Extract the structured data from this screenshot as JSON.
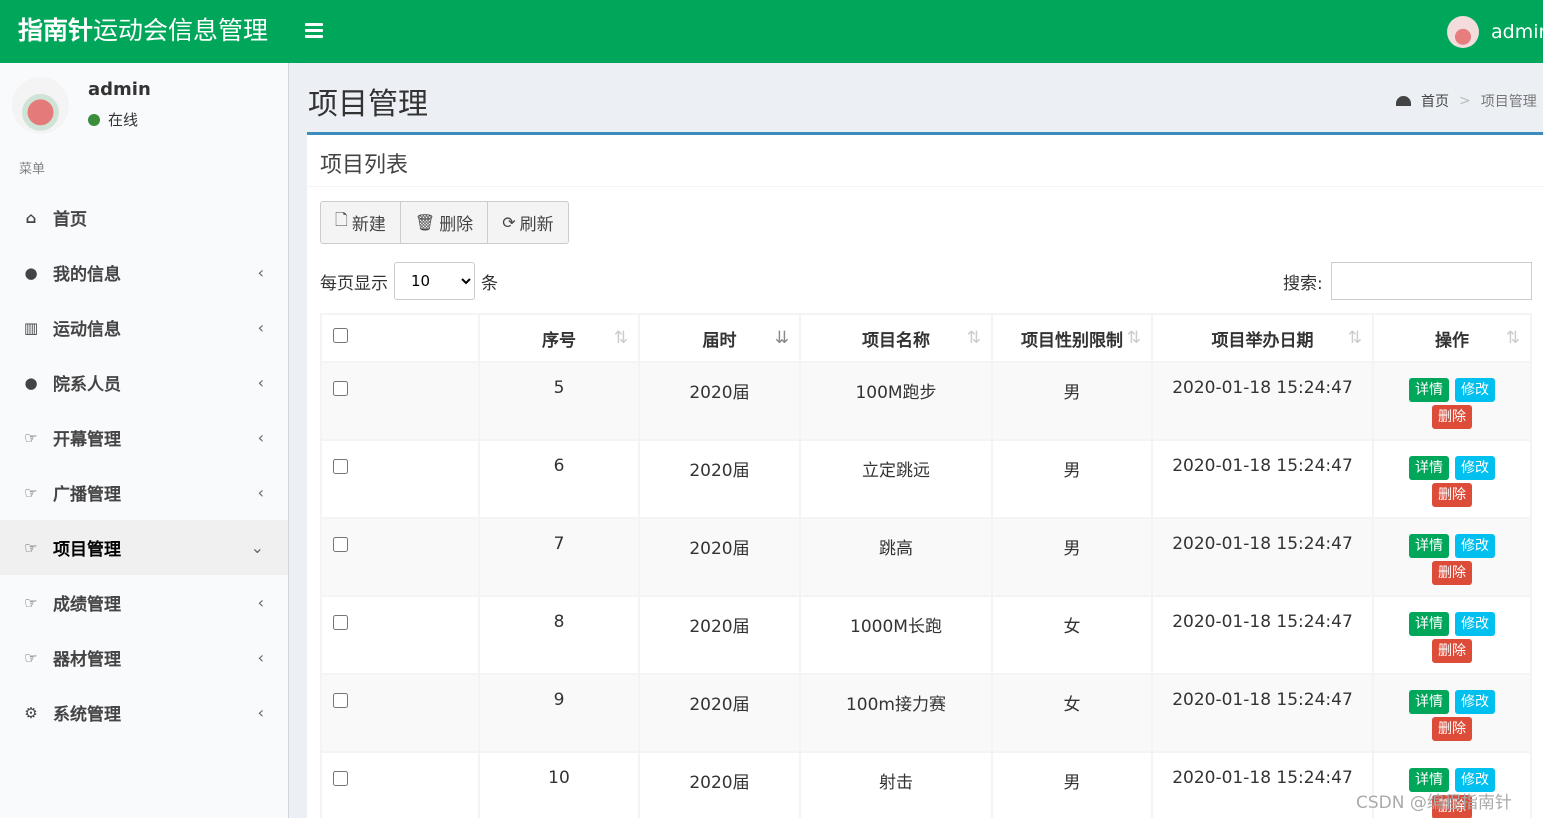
{
  "header": {
    "brand_bold": "指南针",
    "brand_rest": "运动会信息管理",
    "user": "admin"
  },
  "sidebar": {
    "username": "admin",
    "status": "在线",
    "menu_header": "菜单",
    "items": [
      {
        "label": "首页",
        "icon": "home-icon"
      },
      {
        "label": "我的信息",
        "icon": "user-icon"
      },
      {
        "label": "运动信息",
        "icon": "bar-chart-icon"
      },
      {
        "label": "院系人员",
        "icon": "users-icon"
      },
      {
        "label": "开幕管理",
        "icon": "hand-point-icon"
      },
      {
        "label": "广播管理",
        "icon": "hand-point-icon"
      },
      {
        "label": "项目管理",
        "icon": "hand-point-icon"
      },
      {
        "label": "成绩管理",
        "icon": "hand-point-icon"
      },
      {
        "label": "器材管理",
        "icon": "hand-point-icon"
      },
      {
        "label": "系统管理",
        "icon": "gear-icon"
      }
    ]
  },
  "page": {
    "title": "项目管理",
    "breadcrumb_home": "首页",
    "breadcrumb_sep": ">",
    "breadcrumb_current": "项目管理",
    "box_title": "项目列表"
  },
  "toolbar": {
    "new": "新建",
    "delete": "删除",
    "refresh": "刷新"
  },
  "length": {
    "prefix": "每页显示",
    "value": "10",
    "suffix": "条"
  },
  "search": {
    "label": "搜索:"
  },
  "table": {
    "headers": [
      "序号",
      "届时",
      "项目名称",
      "项目性别限制",
      "项目举办日期",
      "操作"
    ],
    "rows": [
      {
        "id": "5",
        "session": "2020届",
        "name": "100M跑步",
        "gender": "男",
        "date": "2020-01-18 15:24:47"
      },
      {
        "id": "6",
        "session": "2020届",
        "name": "立定跳远",
        "gender": "男",
        "date": "2020-01-18 15:24:47"
      },
      {
        "id": "7",
        "session": "2020届",
        "name": "跳高",
        "gender": "男",
        "date": "2020-01-18 15:24:47"
      },
      {
        "id": "8",
        "session": "2020届",
        "name": "1000M长跑",
        "gender": "女",
        "date": "2020-01-18 15:24:47"
      },
      {
        "id": "9",
        "session": "2020届",
        "name": "100m接力赛",
        "gender": "女",
        "date": "2020-01-18 15:24:47"
      },
      {
        "id": "10",
        "session": "2020届",
        "name": "射击",
        "gender": "男",
        "date": "2020-01-18 15:24:47"
      }
    ],
    "actions": {
      "detail": "详情",
      "edit": "修改",
      "delete": "删除"
    }
  },
  "watermark": "CSDN @编程指南针",
  "colors": {
    "header": "#00a65a",
    "box_border": "#3c8dbc",
    "detail": "#00a65a",
    "edit": "#00c0ef",
    "delete": "#dd4b39"
  }
}
